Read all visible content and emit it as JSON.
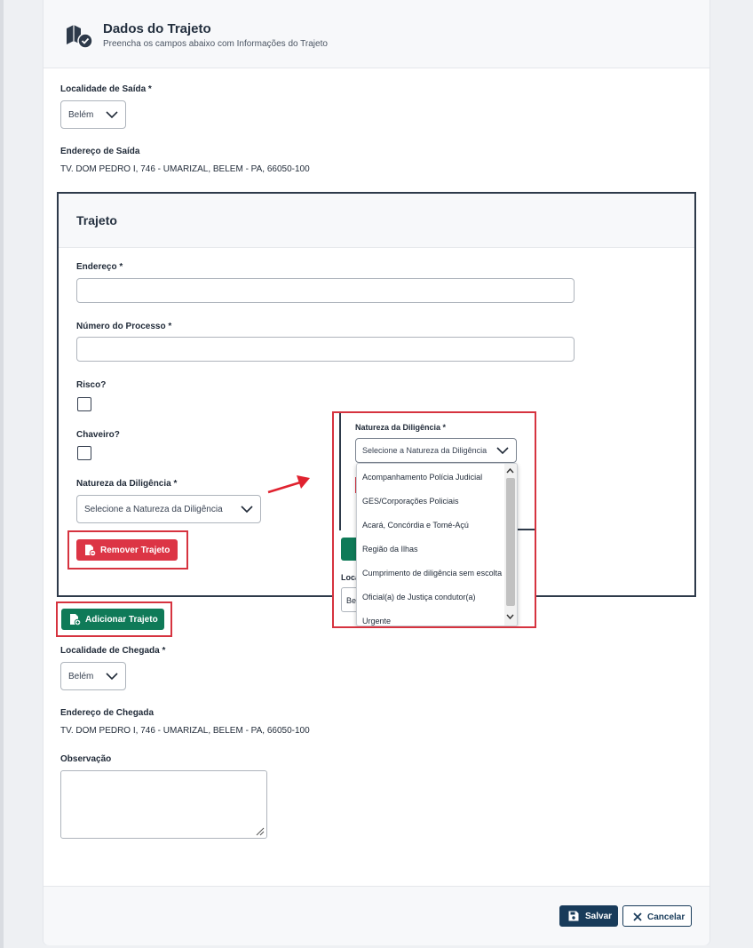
{
  "header": {
    "title": "Dados do Trajeto",
    "subtitle": "Preencha os campos abaixo com Informações do Trajeto",
    "icon": "route-check-icon"
  },
  "saida": {
    "localidade_label": "Localidade de Saída *",
    "localidade_value": "Belém",
    "endereco_label": "Endereço de Saída",
    "endereco_value": "TV. DOM PEDRO I, 746 - UMARIZAL, BELEM - PA, 66050-100"
  },
  "trajeto": {
    "title": "Trajeto",
    "endereco_label": "Endereço *",
    "endereco_value": "",
    "processo_label": "Número do Processo *",
    "processo_value": "",
    "risco_label": "Risco?",
    "risco_checked": false,
    "chaveiro_label": "Chaveiro?",
    "chaveiro_checked": false,
    "natureza_label": "Natureza da Diligência *",
    "natureza_placeholder": "Selecione a Natureza da Diligência",
    "remover_label": "Remover Trajeto"
  },
  "adicionar_label": "Adicionar Trajeto",
  "chegada": {
    "localidade_label": "Localidade de Chegada *",
    "localidade_value": "Belém",
    "endereco_label": "Endereço de Chegada",
    "endereco_value": "TV. DOM PEDRO I, 746 - UMARIZAL, BELEM - PA, 66050-100"
  },
  "observacao": {
    "label": "Observação",
    "value": ""
  },
  "footer": {
    "salvar_label": "Salvar",
    "cancelar_label": "Cancelar"
  },
  "zoom": {
    "natureza_label": "Natureza da Diligência *",
    "natureza_placeholder": "Selecione a Natureza da Diligência",
    "loc_fragment": "Loca",
    "sel_fragment": "Be",
    "options": [
      "Acompanhamento Polícia Judicial",
      "GES/Corporações Policiais",
      "Acará, Concórdia e Tomé-Açú",
      "Região da Ilhas",
      "Cumprimento de diligência sem escolta",
      "Oficial(a) de Justiça condutor(a)",
      "Urgente"
    ]
  },
  "colors": {
    "highlight": "#d6333f",
    "danger": "#dc3545",
    "success": "#0f7a58",
    "primary": "#183b5a",
    "border_dark": "#2e3a4a"
  }
}
